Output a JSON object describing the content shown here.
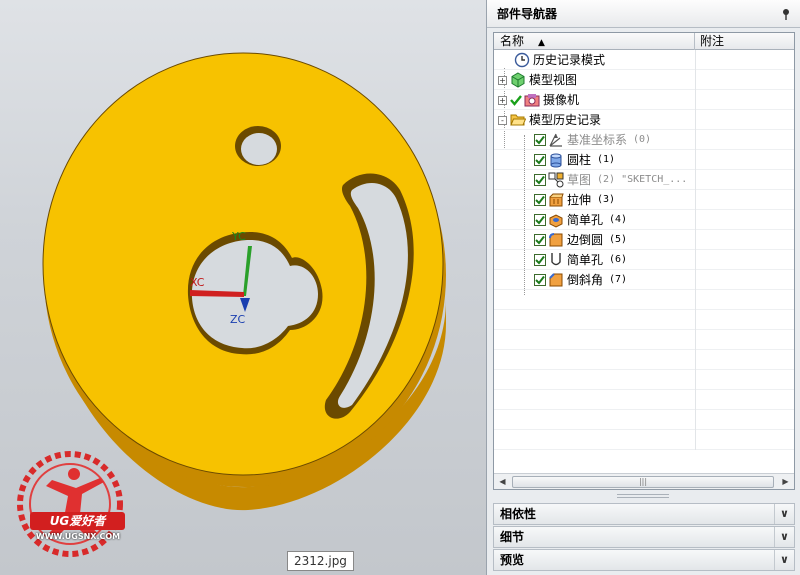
{
  "viewport": {
    "axes": {
      "x_label": "XC",
      "y_label": "YC",
      "z_label": "ZC"
    },
    "model_color": "#F7C200",
    "watermark": {
      "brand": "UG爱好者",
      "url": "WWW.UGSNX.COM"
    },
    "filename_tip": "2312.jpg"
  },
  "navigator": {
    "title": "部件导航器",
    "columns": {
      "name": "名称",
      "note": "附注"
    },
    "rows": [
      {
        "label": "历史记录模式",
        "icon": "clock-icon",
        "level": 0
      },
      {
        "label": "模型视图",
        "icon": "model-views-icon",
        "level": 0,
        "expander": "+"
      },
      {
        "label": "摄像机",
        "icon": "camera-icon",
        "level": 0,
        "expander": "+",
        "check": true
      },
      {
        "label": "模型历史记录",
        "icon": "folder-open-icon",
        "level": 0,
        "expander": "-"
      },
      {
        "label": "基准坐标系",
        "idx": "(0)",
        "icon": "datum-csys-icon",
        "level": 1,
        "grey": true
      },
      {
        "label": "圆柱",
        "idx": "(1)",
        "icon": "cylinder-icon",
        "level": 1
      },
      {
        "label": "草图",
        "idx": "(2) \"SKETCH_...",
        "icon": "sketch-icon",
        "level": 1,
        "grey": true
      },
      {
        "label": "拉伸",
        "idx": "(3)",
        "icon": "extrude-icon",
        "level": 1
      },
      {
        "label": "简单孔",
        "idx": "(4)",
        "icon": "hole-icon",
        "level": 1
      },
      {
        "label": "边倒圆",
        "idx": "(5)",
        "icon": "edge-blend-icon",
        "level": 1
      },
      {
        "label": "简单孔",
        "idx": "(6)",
        "icon": "hole-outline-icon",
        "level": 1
      },
      {
        "label": "倒斜角",
        "idx": "(7)",
        "icon": "chamfer-icon",
        "level": 1
      }
    ],
    "panels": [
      "相依性",
      "细节",
      "预览"
    ]
  }
}
